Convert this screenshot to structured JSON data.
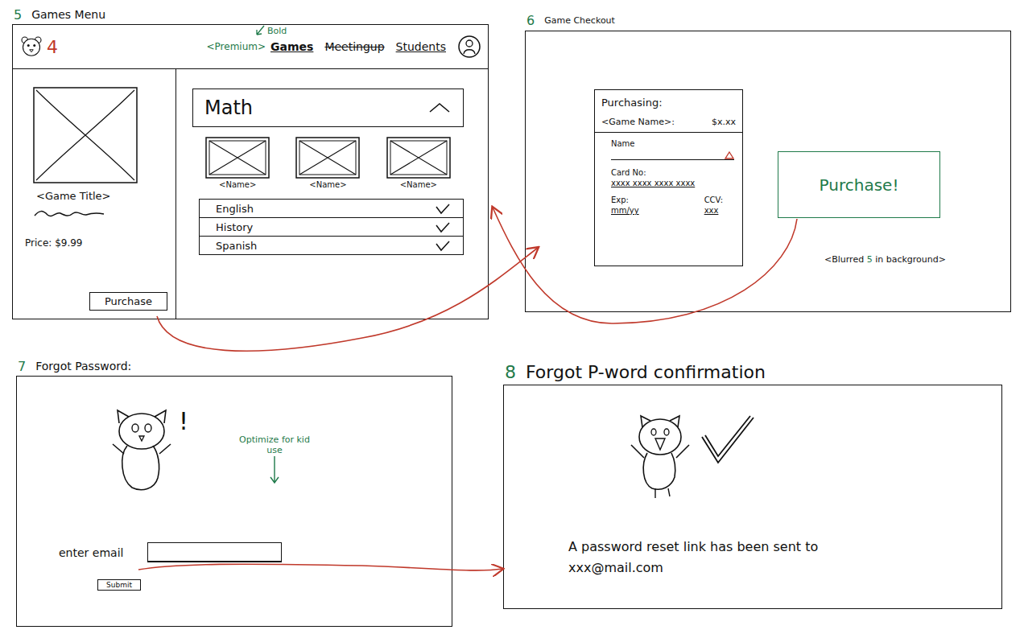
{
  "games_menu": {
    "number": "5",
    "title": "Games Menu",
    "logo_number": "4",
    "bold_note": "Bold",
    "premium": "<Premium>",
    "nav": [
      {
        "label": "Games",
        "selected": true,
        "struck": false
      },
      {
        "label": "Meetingup",
        "selected": false,
        "struck": true
      },
      {
        "label": "Students",
        "selected": false,
        "struck": false
      }
    ],
    "game": {
      "title": "<Game Title>",
      "price": "Price: $9.99",
      "purchase": "Purchase"
    },
    "subject": {
      "label": "Math",
      "expanded": true
    },
    "thumbnails": [
      {
        "name": "<Name>"
      },
      {
        "name": "<Name>"
      },
      {
        "name": "<Name>"
      }
    ],
    "subjects": [
      {
        "label": "English",
        "checked": true
      },
      {
        "label": "History",
        "checked": true
      },
      {
        "label": "Spanish",
        "checked": true
      }
    ]
  },
  "checkout": {
    "number": "6",
    "title": "Game Checkout",
    "summary_label": "Purchasing:",
    "game_name": "<Game Name>:",
    "amount": "$x.xx",
    "name_field": {
      "label": "Name",
      "error": true
    },
    "card_field": {
      "label": "Card No:",
      "value": "xxxx xxxx xxxx xxxx"
    },
    "short_fields": [
      {
        "label": "Exp:",
        "value": "mm/yy"
      },
      {
        "label": "CCV:",
        "value": "xxx"
      }
    ],
    "button": "Purchase!",
    "note_start": "<Blurred ",
    "note_number": "5",
    "note_end": " in background>"
  },
  "forgot_password": {
    "number": "7",
    "title": "Forgot Password:",
    "alert": "!",
    "note": "Optimize for kid use",
    "email_label": "enter email",
    "submit": "Submit"
  },
  "confirmation": {
    "number": "8",
    "title": "Forgot P-word confirmation",
    "message": "A password reset link has been sent to xxx@mail.com"
  }
}
